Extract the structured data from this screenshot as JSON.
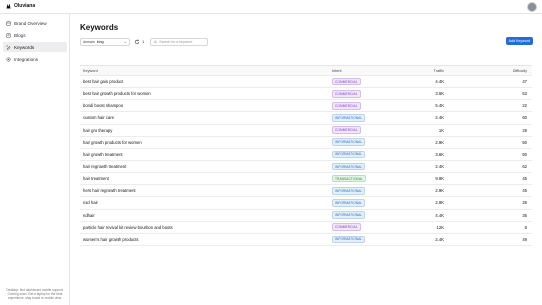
{
  "app": {
    "name": "Oluviana"
  },
  "sidebar": {
    "items": [
      {
        "label": "Brand Overview",
        "icon": "brand-overview-icon",
        "active": false
      },
      {
        "label": "Blogs",
        "icon": "blogs-icon",
        "active": false
      },
      {
        "label": "Keywords",
        "icon": "keywords-icon",
        "active": true
      },
      {
        "label": "Integrations",
        "icon": "integrations-icon",
        "active": false
      }
    ],
    "note": "Desktop: find dashboard mobile support. Coming soon. Get a laptop for the best experience, stay tuned to mobile view."
  },
  "page": {
    "title": "Keywords"
  },
  "toolbar": {
    "domain_prefix": "domain",
    "domain_value": "bing",
    "count": "1",
    "search_placeholder": "Search for a keyword",
    "add_label": "Add Keyword"
  },
  "table": {
    "headers": {
      "keyword": "Keyword",
      "intent": "Intent",
      "traffic": "Traffic",
      "difficulty": "Difficulty"
    },
    "rows": [
      {
        "keyword": "best hair gain product",
        "intent": "COMMERCIAL",
        "traffic": "4.4K",
        "difficulty": "47"
      },
      {
        "keyword": "best hair growth products for women",
        "intent": "COMMERCIAL",
        "traffic": "3.6K",
        "difficulty": "53"
      },
      {
        "keyword": "bondi boost shampoo",
        "intent": "COMMERCIAL",
        "traffic": "5.4K",
        "difficulty": "22"
      },
      {
        "keyword": "custom hair care",
        "intent": "INFORMATIONAL",
        "traffic": "2.4K",
        "difficulty": "60"
      },
      {
        "keyword": "hair gro therapy",
        "intent": "COMMERCIAL",
        "traffic": "1K",
        "difficulty": "29"
      },
      {
        "keyword": "hair growth products for women",
        "intent": "INFORMATIONAL",
        "traffic": "2.9K",
        "difficulty": "50"
      },
      {
        "keyword": "hair growth treatment",
        "intent": "INFORMATIONAL",
        "traffic": "3.6K",
        "difficulty": "50"
      },
      {
        "keyword": "hair regrowth treatment",
        "intent": "INFORMATIONAL",
        "traffic": "2.4K",
        "difficulty": "62"
      },
      {
        "keyword": "hair treatment",
        "intent": "TRANSACTIONAL",
        "traffic": "9.9K",
        "difficulty": "45"
      },
      {
        "keyword": "hers hair regrowth treatment",
        "intent": "INFORMATIONAL",
        "traffic": "2.9K",
        "difficulty": "45"
      },
      {
        "keyword": "nxd hair",
        "intent": "INFORMATIONAL",
        "traffic": "2.9K",
        "difficulty": "26"
      },
      {
        "keyword": "ndhair",
        "intent": "INFORMATIONAL",
        "traffic": "4.4K",
        "difficulty": "35"
      },
      {
        "keyword": "particle hair revival kit review bourbon and boots",
        "intent": "COMMERCIAL",
        "traffic": "12K",
        "difficulty": "8"
      },
      {
        "keyword": "women's hair growth products",
        "intent": "INFORMATIONAL",
        "traffic": "2.4K",
        "difficulty": "49"
      }
    ]
  },
  "colors": {
    "accent": "#1e6fd9",
    "commercial": "#7b3fb3",
    "informational": "#2b6cb5",
    "transactional": "#2e8a46"
  }
}
